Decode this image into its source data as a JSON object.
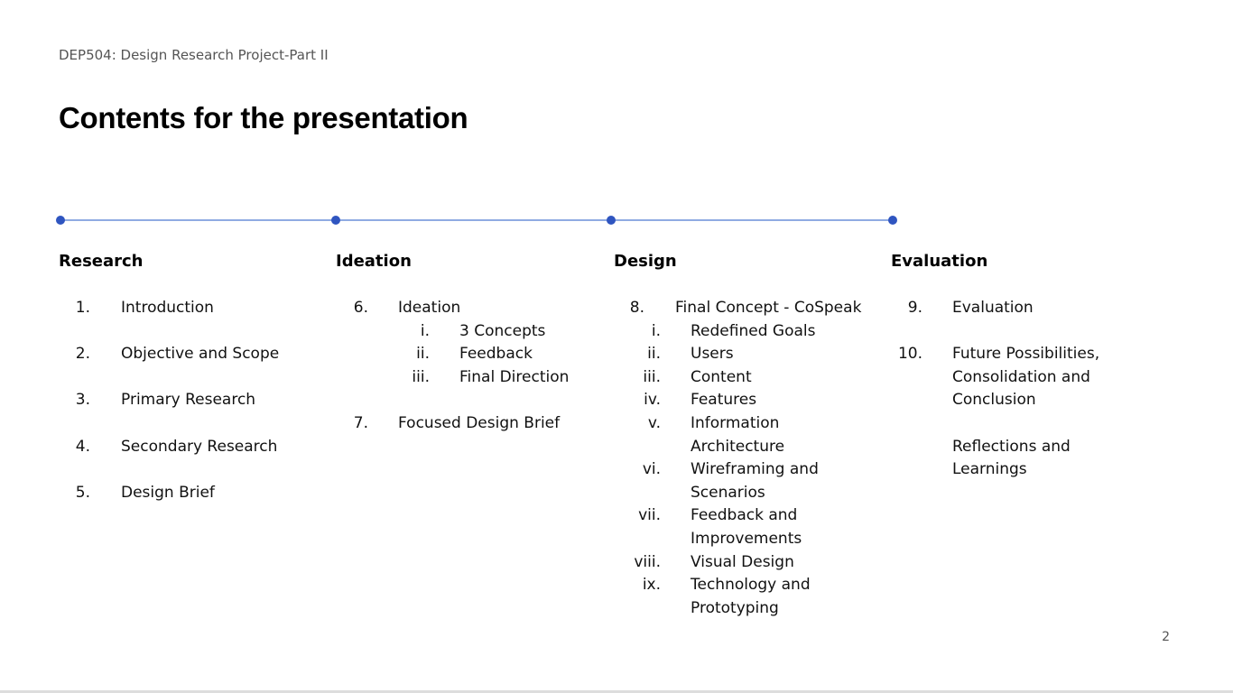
{
  "slide": {
    "course": "DEP504: Design Research Project-Part II",
    "title": "Contents for the presentation",
    "page_number": "2",
    "accent_color": "#2f55c0",
    "line_color": "#6c8fd9"
  },
  "columns": [
    {
      "heading": "Research",
      "items": [
        {
          "num": "1.",
          "label": "Introduction"
        },
        {
          "num": "2.",
          "label": "Objective and Scope"
        },
        {
          "num": "3.",
          "label": "Primary Research"
        },
        {
          "num": "4.",
          "label": "Secondary Research"
        },
        {
          "num": "5.",
          "label": "Design Brief"
        }
      ]
    },
    {
      "heading": "Ideation",
      "items": [
        {
          "num": "6.",
          "label": "Ideation",
          "sub": [
            {
              "num": "i.",
              "label": "3 Concepts"
            },
            {
              "num": "ii.",
              "label": "Feedback"
            },
            {
              "num": "iii.",
              "label": "Final Direction"
            }
          ]
        },
        {
          "num": "7.",
          "label": "Focused Design Brief"
        }
      ]
    },
    {
      "heading": "Design",
      "items": [
        {
          "num": "8.",
          "label": "Final Concept - CoSpeak",
          "sub": [
            {
              "num": "i.",
              "label": "Redefined Goals"
            },
            {
              "num": "ii.",
              "label": "Users"
            },
            {
              "num": "iii.",
              "label": "Content"
            },
            {
              "num": "iv.",
              "label": "Features"
            },
            {
              "num": "v.",
              "label": "Information",
              "label2": "Architecture"
            },
            {
              "num": "vi.",
              "label": "Wireframing and",
              "label2": "Scenarios"
            },
            {
              "num": "vii.",
              "label": "Feedback and",
              "label2": "Improvements"
            },
            {
              "num": "viii.",
              "label": "Visual Design"
            },
            {
              "num": "ix.",
              "label": "Technology and",
              "label2": "Prototyping"
            }
          ]
        }
      ]
    },
    {
      "heading": "Evaluation",
      "items": [
        {
          "num": "9.",
          "label": "Evaluation"
        },
        {
          "num": "10.",
          "label": "Future Possibilities,",
          "label2": "Consolidation and",
          "label3": "Conclusion"
        },
        {
          "num": "",
          "label": "Reflections and",
          "label2": "Learnings"
        }
      ]
    }
  ]
}
